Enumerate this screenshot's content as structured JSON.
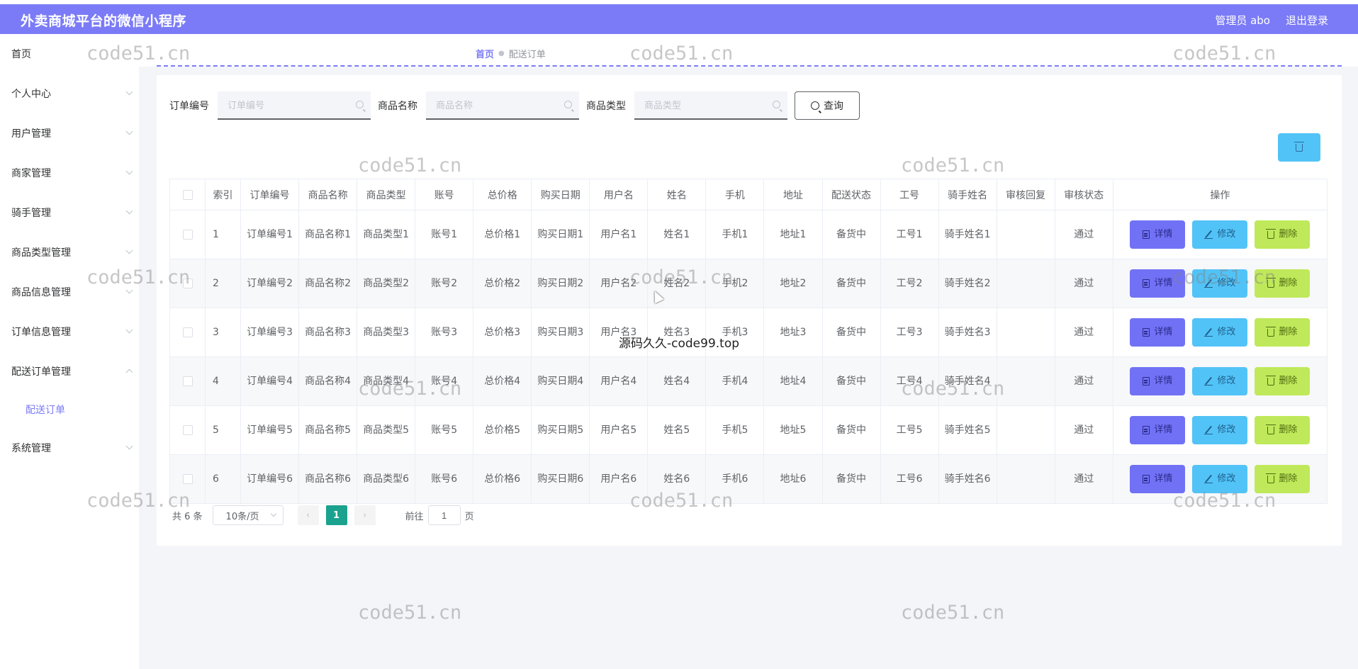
{
  "header": {
    "title": "外卖商城平台的微信小程序",
    "user": "管理员 abo",
    "logout": "退出登录"
  },
  "sidebar": {
    "items": [
      {
        "label": "首页"
      },
      {
        "label": "个人中心"
      },
      {
        "label": "用户管理"
      },
      {
        "label": "商家管理"
      },
      {
        "label": "骑手管理"
      },
      {
        "label": "商品类型管理"
      },
      {
        "label": "商品信息管理"
      },
      {
        "label": "订单信息管理"
      },
      {
        "label": "配送订单管理"
      },
      {
        "label": "系统管理"
      }
    ],
    "sub_active": "配送订单"
  },
  "breadcrumb": {
    "home": "首页",
    "current": "配送订单"
  },
  "search": {
    "order_no_label": "订单编号",
    "order_no_placeholder": "订单编号",
    "product_name_label": "商品名称",
    "product_name_placeholder": "商品名称",
    "product_type_label": "商品类型",
    "product_type_placeholder": "商品类型",
    "query_button": "查询"
  },
  "table": {
    "columns": [
      "索引",
      "订单编号",
      "商品名称",
      "商品类型",
      "账号",
      "总价格",
      "购买日期",
      "用户名",
      "姓名",
      "手机",
      "地址",
      "配送状态",
      "工号",
      "骑手姓名",
      "审核回复",
      "审核状态",
      "操作"
    ],
    "rows": [
      {
        "index": "1",
        "order_no": "订单编号1",
        "product_name": "商品名称1",
        "product_type": "商品类型1",
        "account": "账号1",
        "total": "总价格1",
        "date": "购买日期1",
        "username": "用户名1",
        "name": "姓名1",
        "phone": "手机1",
        "address": "地址1",
        "delivery_status": "备货中",
        "job_no": "工号1",
        "rider_name": "骑手姓名1",
        "reply": "",
        "audit_status": "通过"
      },
      {
        "index": "2",
        "order_no": "订单编号2",
        "product_name": "商品名称2",
        "product_type": "商品类型2",
        "account": "账号2",
        "total": "总价格2",
        "date": "购买日期2",
        "username": "用户名2",
        "name": "姓名2",
        "phone": "手机2",
        "address": "地址2",
        "delivery_status": "备货中",
        "job_no": "工号2",
        "rider_name": "骑手姓名2",
        "reply": "",
        "audit_status": "通过"
      },
      {
        "index": "3",
        "order_no": "订单编号3",
        "product_name": "商品名称3",
        "product_type": "商品类型3",
        "account": "账号3",
        "total": "总价格3",
        "date": "购买日期3",
        "username": "用户名3",
        "name": "姓名3",
        "phone": "手机3",
        "address": "地址3",
        "delivery_status": "备货中",
        "job_no": "工号3",
        "rider_name": "骑手姓名3",
        "reply": "",
        "audit_status": "通过"
      },
      {
        "index": "4",
        "order_no": "订单编号4",
        "product_name": "商品名称4",
        "product_type": "商品类型4",
        "account": "账号4",
        "total": "总价格4",
        "date": "购买日期4",
        "username": "用户名4",
        "name": "姓名4",
        "phone": "手机4",
        "address": "地址4",
        "delivery_status": "备货中",
        "job_no": "工号4",
        "rider_name": "骑手姓名4",
        "reply": "",
        "audit_status": "通过"
      },
      {
        "index": "5",
        "order_no": "订单编号5",
        "product_name": "商品名称5",
        "product_type": "商品类型5",
        "account": "账号5",
        "total": "总价格5",
        "date": "购买日期5",
        "username": "用户名5",
        "name": "姓名5",
        "phone": "手机5",
        "address": "地址5",
        "delivery_status": "备货中",
        "job_no": "工号5",
        "rider_name": "骑手姓名5",
        "reply": "",
        "audit_status": "通过"
      },
      {
        "index": "6",
        "order_no": "订单编号6",
        "product_name": "商品名称6",
        "product_type": "商品类型6",
        "account": "账号6",
        "total": "总价格6",
        "date": "购买日期6",
        "username": "用户名6",
        "name": "姓名6",
        "phone": "手机6",
        "address": "地址6",
        "delivery_status": "备货中",
        "job_no": "工号6",
        "rider_name": "骑手姓名6",
        "reply": "",
        "audit_status": "通过"
      }
    ],
    "actions": {
      "detail": "详情",
      "edit": "修改",
      "delete": "删除"
    }
  },
  "pagination": {
    "total": "共 6 条",
    "page_size": "10条/页",
    "prev": "‹",
    "current": "1",
    "next": "›",
    "goto_label": "前往",
    "goto_value": "1",
    "page_suffix": "页"
  },
  "watermarks": {
    "code51": "code51.cn",
    "code99": "源码久久-code99.top"
  },
  "colors": {
    "header": "#7b7bf7",
    "detail": "#7171f5",
    "edit": "#52c3f7",
    "delete": "#bfe95a",
    "page_active": "#1aa28f"
  }
}
